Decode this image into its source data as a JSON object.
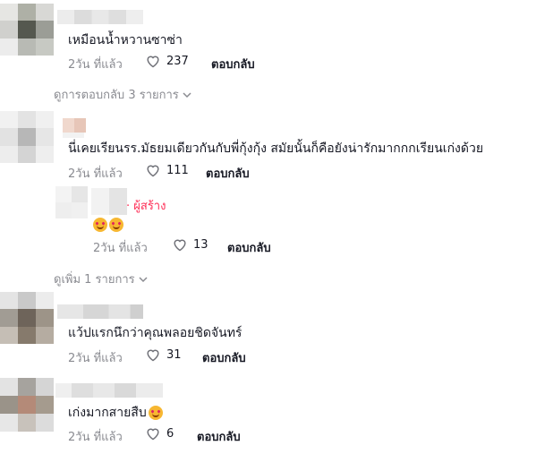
{
  "comments": [
    {
      "text": "เหมือนน้ำหวานซาซ่า",
      "time": "2วัน ที่แล้ว",
      "likes": "237",
      "reply": "ตอบกลับ",
      "more": "ดูการตอบกลับ 3 รายการ"
    },
    {
      "text": "นี่เคยเรียนรร.มัธยมเดียวกันกับพี่กุ้งกุ้ง สมัยนั้นก็คือยังน่ารักมากกกเรียนเก่งด้วย",
      "time": "2วัน ที่แล้ว",
      "likes": "111",
      "reply": "ตอบกลับ",
      "sub": {
        "creator": "· ผู้สร้าง",
        "time": "2วัน ที่แล้ว",
        "likes": "13",
        "reply": "ตอบกลับ"
      },
      "more": "ดูเพิ่ม 1 รายการ"
    },
    {
      "text": "แว้ปแรกนึกว่าคุณพลอยชิดจันทร์",
      "time": "2วัน ที่แล้ว",
      "likes": "31",
      "reply": "ตอบกลับ"
    },
    {
      "text": "เก่งมากสายสืบ",
      "time": "2วัน ที่แล้ว",
      "likes": "6",
      "reply": "ตอบกลับ"
    }
  ],
  "icons": {
    "like": "heart-outline-icon",
    "expand": "chevron-down-icon",
    "emoji": "smiling-face-with-hearts-icon"
  },
  "colors": {
    "creator": "#fe2c55",
    "muted": "#8a8b91",
    "text": "#161823"
  }
}
